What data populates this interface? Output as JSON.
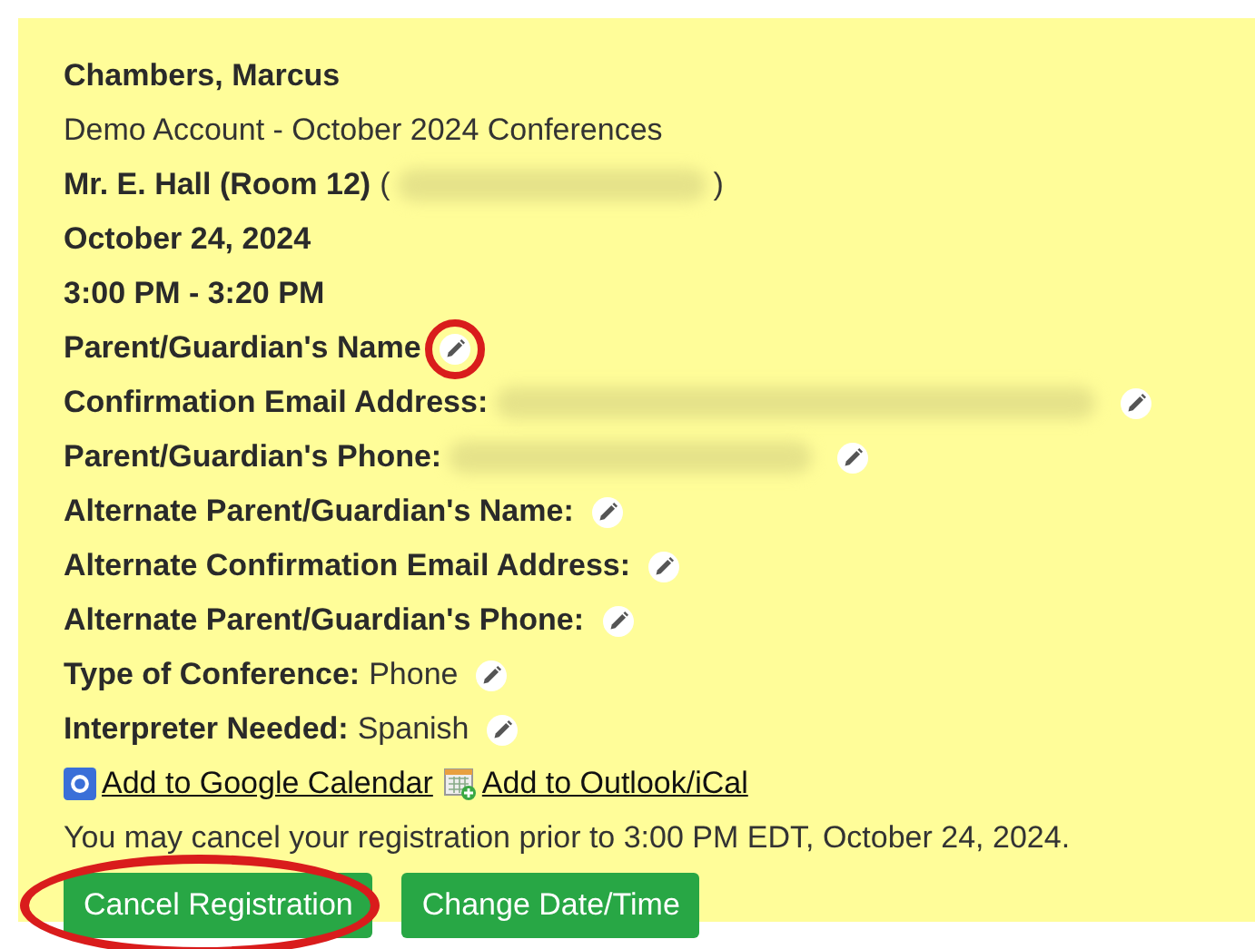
{
  "student": {
    "name": "Chambers, Marcus"
  },
  "account": "Demo Account - October 2024 Conferences",
  "teacher": {
    "name": "Mr. E. Hall (Room 12)",
    "open": "(",
    "close": ")",
    "redacted": true
  },
  "date": "October 24, 2024",
  "time": "3:00 PM - 3:20 PM",
  "fields": [
    {
      "label": "Parent/Guardian's Name",
      "redacted": false,
      "editable": true,
      "annotated": true
    },
    {
      "label": "Confirmation Email Address:",
      "redacted": true,
      "editable": true,
      "annotated": false
    },
    {
      "label": "Parent/Guardian's Phone:",
      "redacted": true,
      "editable": true,
      "annotated": false
    },
    {
      "label": "Alternate Parent/Guardian's Name:",
      "redacted": false,
      "editable": true,
      "annotated": false
    },
    {
      "label": "Alternate Confirmation Email Address:",
      "redacted": false,
      "editable": true,
      "annotated": false
    },
    {
      "label": "Alternate Parent/Guardian's Phone:",
      "redacted": false,
      "editable": true,
      "annotated": false
    },
    {
      "label": "Type of Conference:",
      "value": "Phone",
      "redacted": false,
      "editable": true,
      "annotated": false
    },
    {
      "label": "Interpreter Needed:",
      "value": "Spanish",
      "redacted": false,
      "editable": true,
      "annotated": false
    }
  ],
  "links": [
    {
      "kind": "google",
      "label": "Add to Google Calendar"
    },
    {
      "kind": "outlook",
      "label": "Add to Outlook/iCal"
    }
  ],
  "notice": "You may cancel your registration prior to 3:00 PM EDT, October 24, 2024.",
  "buttons": [
    {
      "label": "Cancel Registration",
      "annotated": true
    },
    {
      "label": "Change Date/Time",
      "annotated": false
    }
  ]
}
